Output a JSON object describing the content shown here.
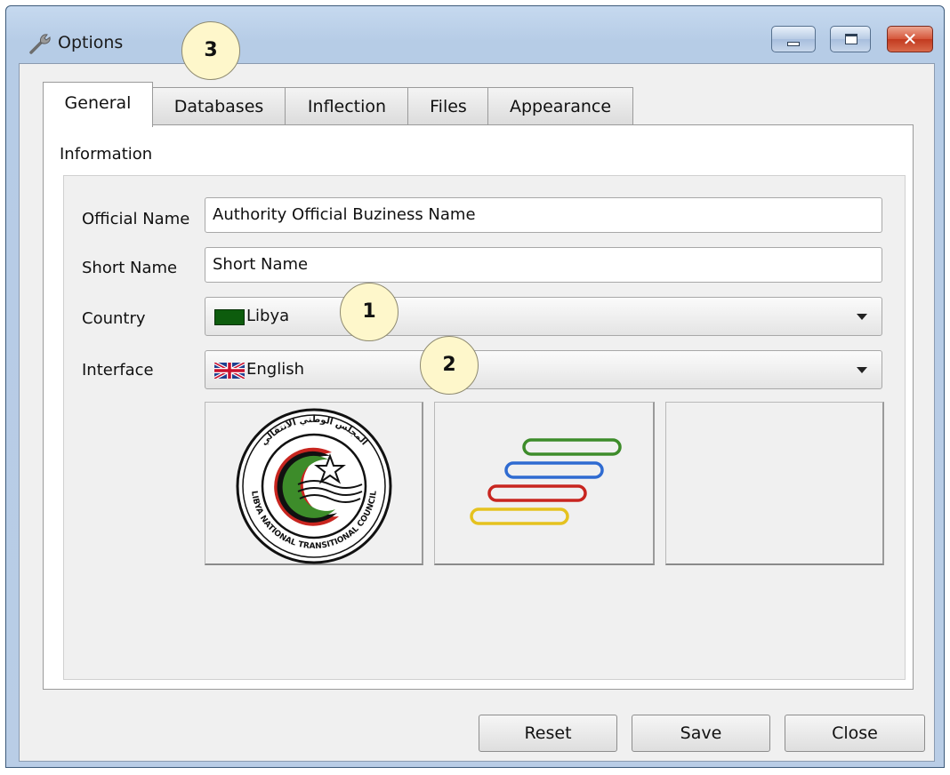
{
  "window": {
    "title": "Options"
  },
  "tabs": [
    {
      "label": "General",
      "active": true
    },
    {
      "label": "Databases",
      "active": false
    },
    {
      "label": "Inflection",
      "active": false
    },
    {
      "label": "Files",
      "active": false
    },
    {
      "label": "Appearance",
      "active": false
    }
  ],
  "general": {
    "section_label": "Information",
    "fields": {
      "official_name": {
        "label": "Official Name",
        "value": "Authority Official Buziness Name"
      },
      "short_name": {
        "label": "Short Name",
        "value": "Short Name"
      },
      "country": {
        "label": "Country",
        "value": "Libya",
        "icon": "libya-flag-icon"
      },
      "interface": {
        "label": "Interface",
        "value": "English",
        "icon": "uk-flag-icon"
      }
    },
    "seal": {
      "arabic_text": "المجلس الوطني الانتقالي",
      "english_text": "LIBYA NATIONAL TRANSITIONAL COUNCIL"
    }
  },
  "buttons": {
    "reset": "Reset",
    "save": "Save",
    "close": "Close"
  },
  "callouts": [
    "1",
    "2",
    "3"
  ],
  "colors": {
    "title_gradient_top": "#c6d9ef",
    "window_bg": "#f0f0f0",
    "close_button": "#c23a1f",
    "callout_fill": "#fef7cb",
    "logo_green": "#3d8c2a",
    "logo_blue": "#2f6bd1",
    "logo_red": "#c8251f",
    "logo_yellow": "#e5c21f"
  }
}
